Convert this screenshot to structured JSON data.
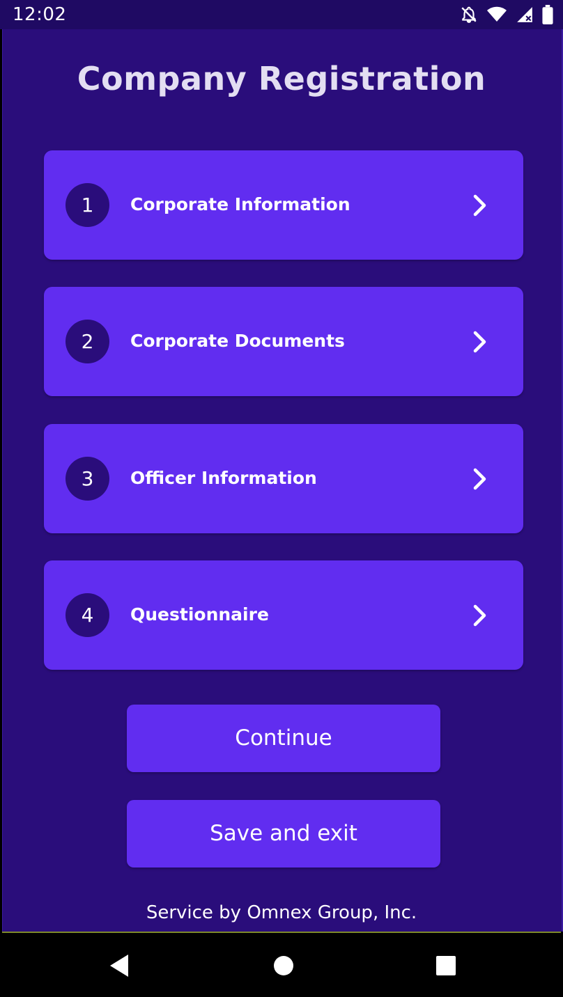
{
  "status_bar": {
    "time": "12:02",
    "icons": [
      "notifications-off-icon",
      "wifi-icon",
      "signal-icon",
      "battery-icon"
    ]
  },
  "title": "Company Registration",
  "steps": [
    {
      "number": "1",
      "label": "Corporate Information"
    },
    {
      "number": "2",
      "label": "Corporate Documents"
    },
    {
      "number": "3",
      "label": "Officer Information"
    },
    {
      "number": "4",
      "label": "Questionnaire"
    }
  ],
  "buttons": {
    "continue": "Continue",
    "save_exit": "Save and exit"
  },
  "footer": "Service by Omnex Group, Inc.",
  "nav_bar": {
    "icons": [
      "back-icon",
      "home-icon",
      "recents-icon"
    ]
  },
  "colors": {
    "background": "#2a0d7b",
    "status_bar": "#1f0a63",
    "card": "#612df0",
    "title_text": "#e3def2"
  }
}
